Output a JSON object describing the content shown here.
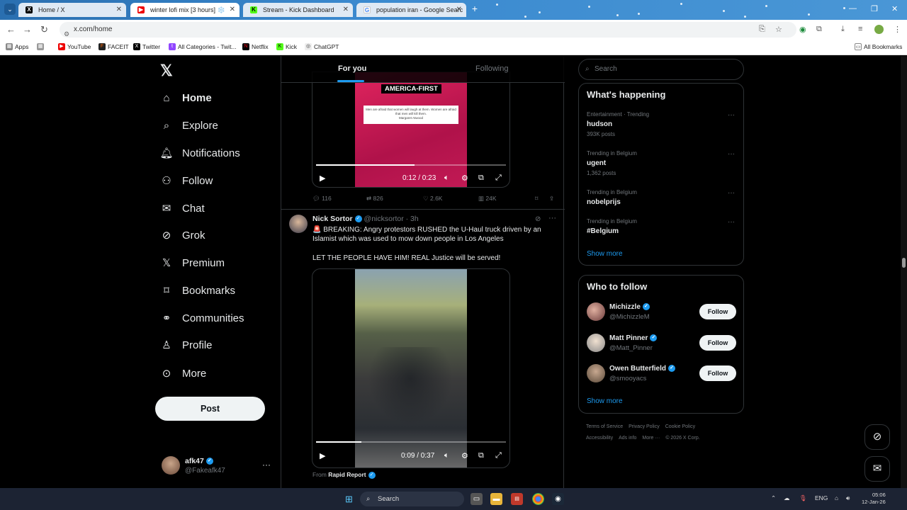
{
  "browser": {
    "tabs": [
      {
        "title": "Home / X",
        "favicon": "x-icon",
        "active": false
      },
      {
        "title": "winter lofi mix [3 hours] ❄️",
        "favicon": "youtube-icon",
        "active": true
      },
      {
        "title": "Stream - Kick Dashboard",
        "favicon": "kick-icon",
        "active": false
      },
      {
        "title": "population iran - Google Searc",
        "favicon": "google-icon",
        "active": false
      }
    ],
    "url": "x.com/home",
    "bookmarks": [
      "Apps",
      "YouTube",
      "FACEIT",
      "Twitter",
      "All Categories - Twit...",
      "Netflix",
      "Kick",
      "ChatGPT"
    ],
    "all_bookmarks": "All Bookmarks"
  },
  "nav": {
    "items": [
      {
        "label": "Home",
        "icon": "home-icon"
      },
      {
        "label": "Explore",
        "icon": "search-icon"
      },
      {
        "label": "Notifications",
        "icon": "bell-icon"
      },
      {
        "label": "Follow",
        "icon": "add-person-icon"
      },
      {
        "label": "Chat",
        "icon": "mail-icon"
      },
      {
        "label": "Grok",
        "icon": "grok-icon"
      },
      {
        "label": "Premium",
        "icon": "x-icon"
      },
      {
        "label": "Bookmarks",
        "icon": "bookmark-icon"
      },
      {
        "label": "Communities",
        "icon": "people-icon"
      },
      {
        "label": "Profile",
        "icon": "person-icon"
      },
      {
        "label": "More",
        "icon": "more-circle-icon"
      }
    ],
    "post_label": "Post"
  },
  "account": {
    "name": "afk47",
    "handle": "@Fakeafk47"
  },
  "feed": {
    "tabs": [
      "For you",
      "Following"
    ],
    "first_post": {
      "video_caption": "AMERICA-FIRST",
      "video_quote": "Men are afraid that women will laugh at them. Women are afraid that men will kill them.",
      "video_quote_author": "Margaret Atwood",
      "time": "0:12 / 0:23",
      "progress": 0.52,
      "replies": "116",
      "reposts": "826",
      "likes": "2.6K",
      "views": "24K"
    },
    "second_post": {
      "author": "Nick Sortor",
      "handle": "@nicksortor",
      "age": "· 3h",
      "text1": "🚨 BREAKING: Angry protestors RUSHED the U-Haul truck driven by an Islamist which was used to mow down people in Los Angeles",
      "text2": "LET THE PEOPLE HAVE HIM! REAL Justice will be served!",
      "time": "0:09 / 0:37",
      "progress": 0.24,
      "from_label": "From",
      "from_source": "Rapid Report"
    }
  },
  "sidebar": {
    "search_placeholder": "Search",
    "happening_title": "What's happening",
    "trends": [
      {
        "meta": "Entertainment · Trending",
        "name": "hudson",
        "count": "393K posts"
      },
      {
        "meta": "Trending in Belgium",
        "name": "ugent",
        "count": "1,362 posts"
      },
      {
        "meta": "Trending in Belgium",
        "name": "nobelprijs",
        "count": ""
      },
      {
        "meta": "Trending in Belgium",
        "name": "#Belgium",
        "count": ""
      }
    ],
    "show_more": "Show more",
    "who_to_follow_title": "Who to follow",
    "suggestions": [
      {
        "name": "Michizzle",
        "handle": "@MichizzleM"
      },
      {
        "name": "Matt Pinner",
        "handle": "@Matt_Pinner"
      },
      {
        "name": "Owen Butterfield",
        "handle": "@smooyacs"
      }
    ],
    "follow_label": "Follow",
    "footer": [
      "Terms of Service",
      "Privacy Policy",
      "Cookie Policy",
      "Accessibility",
      "Ads info",
      "More ···",
      "© 2026 X Corp."
    ]
  },
  "taskbar": {
    "search_label": "Search",
    "lang": "ENG",
    "time": "05:06",
    "date": "12-Jan-26"
  },
  "colors": {
    "accent": "#1d9bf0",
    "background": "#000000",
    "border": "#2f3336",
    "muted": "#71767b"
  }
}
